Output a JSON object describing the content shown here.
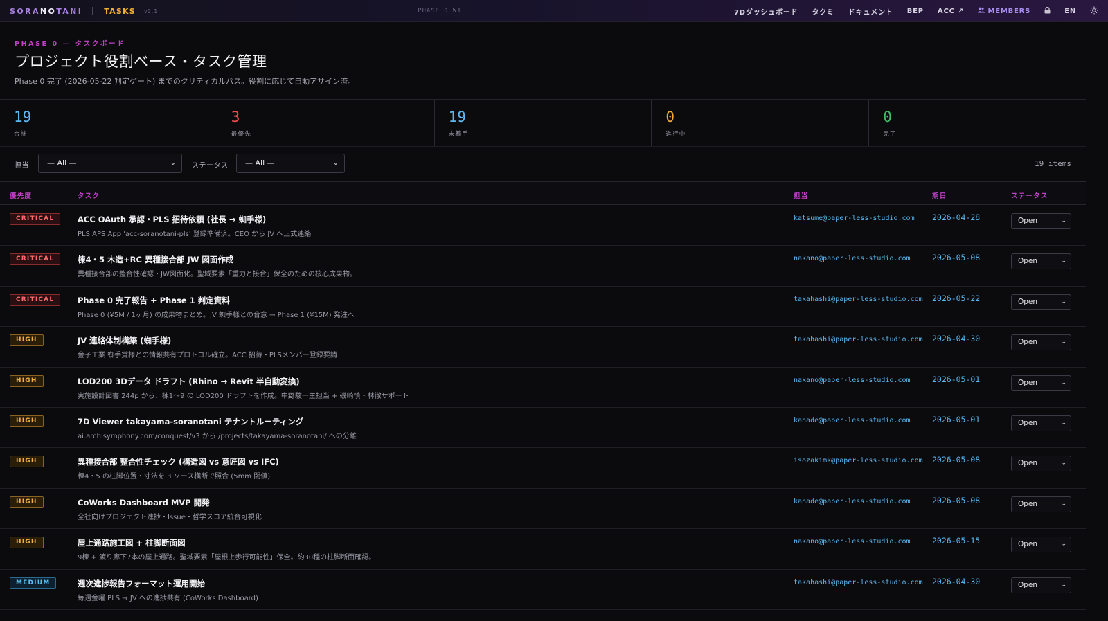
{
  "topbar": {
    "brand_pre": "SORA",
    "brand_hl": "NO",
    "brand_post": "TANI",
    "app": "TASKS",
    "version": "v0.1",
    "phase": "PHASE 0 W1",
    "nav": [
      {
        "label": "7Dダッシュボード"
      },
      {
        "label": "タクミ"
      },
      {
        "label": "ドキュメント"
      },
      {
        "label": "BEP"
      },
      {
        "label": "ACC ↗"
      },
      {
        "label": "MEMBERS"
      }
    ],
    "lang": "EN",
    "members_icon": "people-icon",
    "lock_icon": "lock-icon",
    "theme_icon": "sun-icon"
  },
  "header": {
    "eyebrow": "PHASE 0 — タスクボード",
    "title": "プロジェクト役割ベース・タスク管理",
    "subtitle": "Phase 0 完了 (2026-05-22 判定ゲート) までのクリティカルパス。役割に応じて自動アサイン済。"
  },
  "stats": [
    {
      "value": "19",
      "label": "合計",
      "color": "#5cb8f0"
    },
    {
      "value": "3",
      "label": "最優先",
      "color": "#ef4d4d"
    },
    {
      "value": "19",
      "label": "未着手",
      "color": "#5cb8f0"
    },
    {
      "value": "0",
      "label": "進行中",
      "color": "#f0a830"
    },
    {
      "value": "0",
      "label": "完了",
      "color": "#3cc060"
    }
  ],
  "filters": {
    "assignee_label": "担当",
    "assignee_value": "— All —",
    "status_label": "ステータス",
    "status_value": "— All —",
    "count": "19 items"
  },
  "table": {
    "headers": {
      "priority": "優先度",
      "task": "タスク",
      "assignee": "担当",
      "due": "期日",
      "status": "ステータス"
    },
    "rows": [
      {
        "priority": "CRITICAL",
        "level": "critical",
        "title": "ACC OAuth 承認・PLS 招待依頼 (社長 → 蜘手様)",
        "desc": "PLS APS App 'acc-soranotani-pls' 登録準備済。CEO から JV へ正式連絡",
        "assignee": "katsume@paper-less-studio.com",
        "due": "2026-04-28",
        "status": "Open"
      },
      {
        "priority": "CRITICAL",
        "level": "critical",
        "title": "棟4・5 木造+RC 異種接合部 JW 図面作成",
        "desc": "異種接合部の整合性確認・JW図面化。聖域要素「重力と接合」保全のための核心成果物。",
        "assignee": "nakano@paper-less-studio.com",
        "due": "2026-05-08",
        "status": "Open"
      },
      {
        "priority": "CRITICAL",
        "level": "critical",
        "title": "Phase 0 完了報告 + Phase 1 判定資料",
        "desc": "Phase 0 (¥5M / 1ヶ月) の成果物まとめ。JV 蜘手様との合意 → Phase 1 (¥15M) 発注へ",
        "assignee": "takahashi@paper-less-studio.com",
        "due": "2026-05-22",
        "status": "Open"
      },
      {
        "priority": "HIGH",
        "level": "high",
        "title": "JV 連絡体制構築 (蜘手様)",
        "desc": "金子工業 蜘手賞様との情報共有プロトコル確立。ACC 招待・PLSメンバー登録要請",
        "assignee": "takahashi@paper-less-studio.com",
        "due": "2026-04-30",
        "status": "Open"
      },
      {
        "priority": "HIGH",
        "level": "high",
        "title": "LOD200 3Dデータ ドラフト (Rhino → Revit 半自動変換)",
        "desc": "実施設計図書 244p から、棟1〜9 の LOD200 ドラフトを作成。中野駿一主担当 + 磯崎慎・林徹サポート",
        "assignee": "nakano@paper-less-studio.com",
        "due": "2026-05-01",
        "status": "Open"
      },
      {
        "priority": "HIGH",
        "level": "high",
        "title": "7D Viewer takayama-soranotani テナントルーティング",
        "desc": "ai.archisymphony.com/conquest/v3 から /projects/takayama-soranotani/ への分離",
        "assignee": "kanade@paper-less-studio.com",
        "due": "2026-05-01",
        "status": "Open"
      },
      {
        "priority": "HIGH",
        "level": "high",
        "title": "異種接合部 整合性チェック (構造図 vs 意匠図 vs IFC)",
        "desc": "棟4・5 の柱脚位置・寸法を 3 ソース横断で照合 (5mm 閾値)",
        "assignee": "isozakimk@paper-less-studio.com",
        "due": "2026-05-08",
        "status": "Open"
      },
      {
        "priority": "HIGH",
        "level": "high",
        "title": "CoWorks Dashboard MVP 開発",
        "desc": "全社向けプロジェクト進捗・Issue・哲学スコア統合可視化",
        "assignee": "kanade@paper-less-studio.com",
        "due": "2026-05-08",
        "status": "Open"
      },
      {
        "priority": "HIGH",
        "level": "high",
        "title": "屋上通路施工図 + 柱脚断面図",
        "desc": "9棟 + 渡り廊下7本の屋上通路。聖域要素「屋根上歩行可能性」保全。約30種の柱脚断面確認。",
        "assignee": "nakano@paper-less-studio.com",
        "due": "2026-05-15",
        "status": "Open"
      },
      {
        "priority": "MEDIUM",
        "level": "medium",
        "title": "週次進捗報告フォーマット運用開始",
        "desc": "毎週金曜 PLS → JV への進捗共有 (CoWorks Dashboard)",
        "assignee": "takahashi@paper-less-studio.com",
        "due": "2026-04-30",
        "status": "Open"
      }
    ]
  }
}
